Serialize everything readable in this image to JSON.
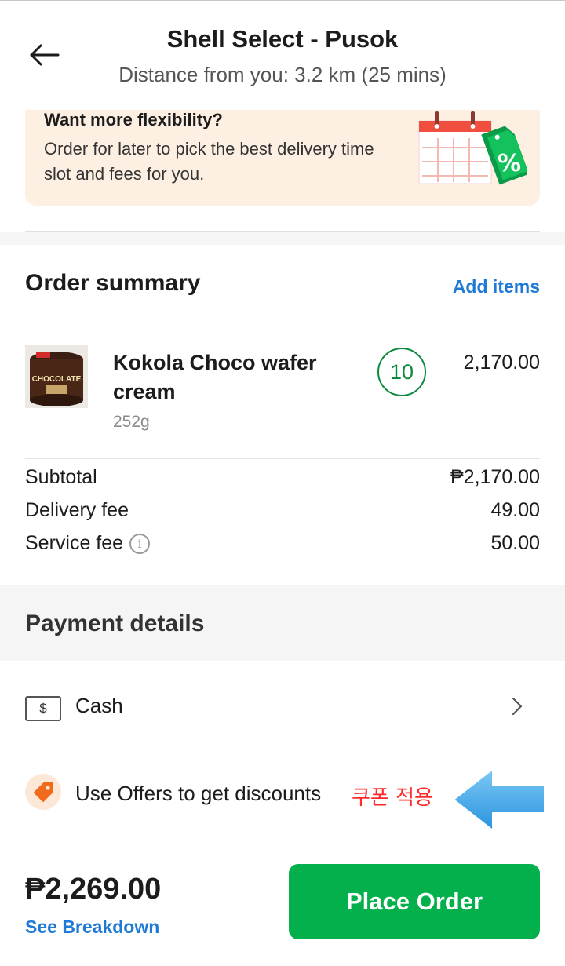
{
  "header": {
    "title": "Shell Select - Pusok",
    "subtitle": "Distance from you: 3.2 km (25 mins)"
  },
  "banner": {
    "title": "Want more flexibility?",
    "text": "Order for later to pick the best delivery time slot and fees for you.",
    "tag_symbol": "%"
  },
  "order_summary": {
    "title": "Order summary",
    "add_items": "Add items",
    "item": {
      "name": "Kokola Choco wafer cream",
      "weight": "252g",
      "quantity": "10",
      "price": "2,170.00",
      "image_text": "CHOCOLATE"
    },
    "fees": [
      {
        "label": "Subtotal",
        "value": "₱2,170.00"
      },
      {
        "label": "Delivery fee",
        "value": "49.00"
      },
      {
        "label": "Service fee",
        "value": "50.00"
      }
    ],
    "info_symbol": "i"
  },
  "payment": {
    "title": "Payment details",
    "cash_symbol": "$",
    "cash_label": "Cash",
    "offers_label": "Use Offers to get discounts",
    "annotation": "쿠폰 적용"
  },
  "footer": {
    "total": "₱2,269.00",
    "breakdown": "See Breakdown",
    "place_order": "Place Order"
  },
  "colors": {
    "brand_green": "#03b04b",
    "link_blue": "#1f7ad6",
    "banner_bg": "#fdefe2",
    "annotation_red": "#ff2a2a",
    "arrow_blue": "#3ea6e8"
  }
}
